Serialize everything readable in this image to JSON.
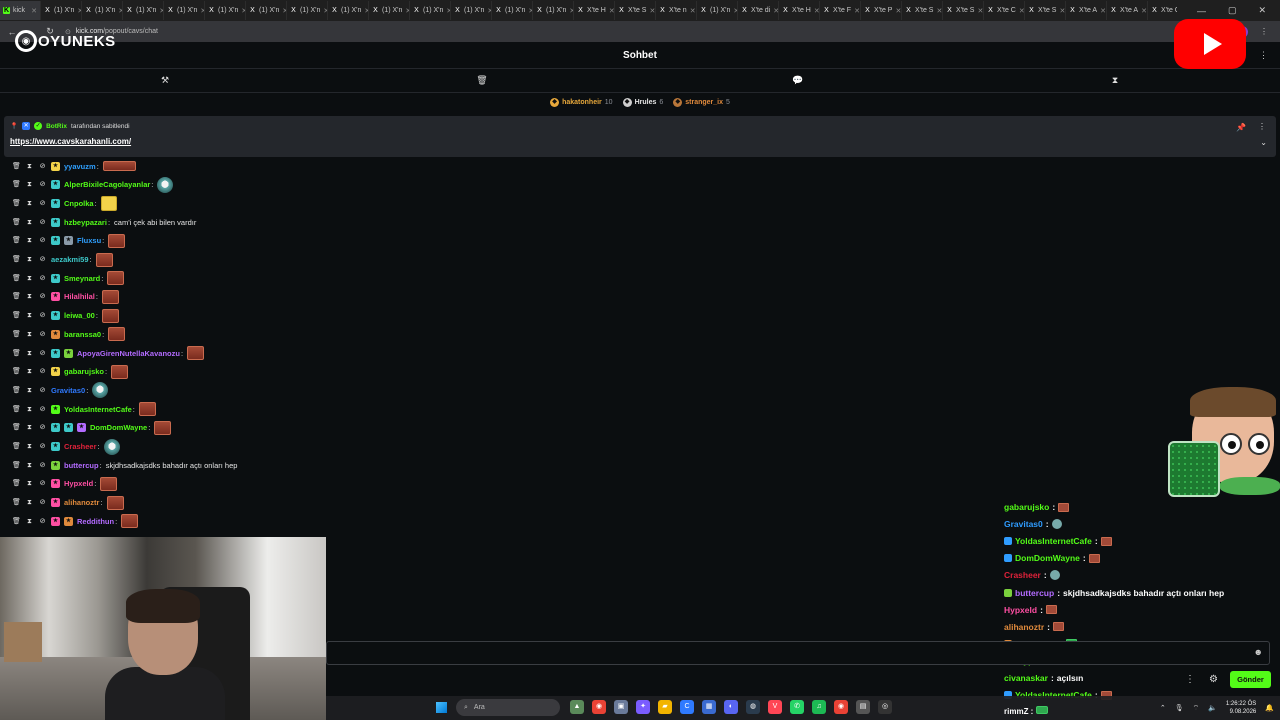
{
  "browser": {
    "tabs": [
      {
        "label": "kick",
        "active": true,
        "fav": "K"
      },
      {
        "label": "(1) X'n",
        "fav": "X"
      },
      {
        "label": "(1) X'n",
        "fav": "X"
      },
      {
        "label": "(1) X'n",
        "fav": "X"
      },
      {
        "label": "(1) X'n",
        "fav": "X"
      },
      {
        "label": "(1) X'n",
        "fav": "X"
      },
      {
        "label": "(1) X'n",
        "fav": "X"
      },
      {
        "label": "(1) X'n",
        "fav": "X"
      },
      {
        "label": "(1) X'n",
        "fav": "X"
      },
      {
        "label": "(1) X'n",
        "fav": "X"
      },
      {
        "label": "(1) X'n",
        "fav": "X"
      },
      {
        "label": "(1) X'n",
        "fav": "X"
      },
      {
        "label": "(1) X'n",
        "fav": "X"
      },
      {
        "label": "(1) X'n",
        "fav": "X"
      },
      {
        "label": "X'te H",
        "fav": "X"
      },
      {
        "label": "X'te S",
        "fav": "X"
      },
      {
        "label": "X'te n",
        "fav": "X"
      },
      {
        "label": "(1) X'n",
        "fav": "X"
      },
      {
        "label": "X'te di",
        "fav": "X"
      },
      {
        "label": "X'te H",
        "fav": "X"
      },
      {
        "label": "X'te F",
        "fav": "X"
      },
      {
        "label": "X'te P",
        "fav": "X"
      },
      {
        "label": "X'te S",
        "fav": "X"
      },
      {
        "label": "X'te S",
        "fav": "X"
      },
      {
        "label": "X'te C",
        "fav": "X"
      },
      {
        "label": "X'te S",
        "fav": "X"
      },
      {
        "label": "X'te A",
        "fav": "X"
      },
      {
        "label": "X'te A",
        "fav": "X"
      },
      {
        "label": "X'te G",
        "fav": "X"
      }
    ],
    "new_tab": "+",
    "url_host": "kick.com",
    "url_path": "/popout/cavs/chat",
    "profile": "C"
  },
  "overlay": {
    "logo_text": "OYUNEKS",
    "logo_o": "◉"
  },
  "header": {
    "title": "Sohbet",
    "menu_icon": "⋮"
  },
  "toolbar": {
    "icons": [
      {
        "name": "hammer-icon",
        "glyph": "⚒"
      },
      {
        "name": "trash-icon",
        "glyph": "🗑"
      },
      {
        "name": "chat-bubble-icon",
        "glyph": "💬"
      },
      {
        "name": "hourglass-icon",
        "glyph": "⧗"
      }
    ]
  },
  "gifters": [
    {
      "name": "hakatonheir",
      "count": "10",
      "color": "#e7a83b",
      "coin": "#e7a83b"
    },
    {
      "name": "Hrules",
      "count": "6",
      "color": "#e6e6e6",
      "coin": "#cfcfcf"
    },
    {
      "name": "stranger_ix",
      "count": "5",
      "color": "#e08a3c",
      "coin": "#b9773a"
    }
  ],
  "pinned": {
    "author": "BotRix",
    "suffix": "tarafından sabitlendi",
    "link": "https://www.cavskarahanli.com/",
    "pin_icon": "📌",
    "menu_icon": "⋮",
    "chevron_icon": "⌄"
  },
  "messages": [
    {
      "user": "yyavuzm",
      "color": "#2fa0ff",
      "badges": [
        "#f3d34a"
      ],
      "text": "",
      "emote": "wide"
    },
    {
      "user": "AlperBixileCagolayanlar",
      "color": "#53fc18",
      "badges": [
        "#3dc9c9"
      ],
      "text": "",
      "emote": "face"
    },
    {
      "user": "Cnpolka",
      "color": "#53fc18",
      "badges": [
        "#3dc9c9"
      ],
      "text": "",
      "emote": "coin"
    },
    {
      "user": "hzbeypazari",
      "color": "#53fc18",
      "badges": [
        "#3dc9c9"
      ],
      "text": "cam'i çek abi bilen vardır",
      "emote": ""
    },
    {
      "user": "Fluxsu",
      "color": "#2fa0ff",
      "badges": [
        "#3dc9c9",
        "#8a9aa8"
      ],
      "text": "",
      "emote": "box"
    },
    {
      "user": "aezakmi59",
      "color": "#3dc9c9",
      "badges": [],
      "text": "",
      "emote": "box"
    },
    {
      "user": "Smeynard",
      "color": "#53fc18",
      "badges": [
        "#3dc9c9"
      ],
      "text": "",
      "emote": "box"
    },
    {
      "user": "Hilalhilal",
      "color": "#ff4fa3",
      "badges": [
        "#ff4fa3"
      ],
      "text": "",
      "emote": "box"
    },
    {
      "user": "leiwa_00",
      "color": "#53fc18",
      "badges": [
        "#3dc9c9"
      ],
      "text": "",
      "emote": "box"
    },
    {
      "user": "baranssa0",
      "color": "#53fc18",
      "badges": [
        "#e08a3c"
      ],
      "text": "",
      "emote": "box"
    },
    {
      "user": "ApoyaGirenNutellaKavanozu",
      "color": "#b36bff",
      "badges": [
        "#3dc9c9",
        "#7bd13d"
      ],
      "text": "",
      "emote": "box"
    },
    {
      "user": "gabarujsko",
      "color": "#53fc18",
      "badges": [
        "#f3d34a"
      ],
      "text": "",
      "emote": "box"
    },
    {
      "user": "Gravitas0",
      "color": "#2f7aff",
      "badges": [],
      "text": "",
      "emote": "face"
    },
    {
      "user": "YoldasInternetCafe",
      "color": "#53fc18",
      "badges": [
        "#53fc18"
      ],
      "text": "",
      "emote": "box"
    },
    {
      "user": "DomDomWayne",
      "color": "#53fc18",
      "badges": [
        "#3dc9c9",
        "#3dc9c9",
        "#b36bff"
      ],
      "text": "",
      "emote": "box"
    },
    {
      "user": "Crasheer",
      "color": "#e0223a",
      "badges": [
        "#3dc9c9"
      ],
      "text": "",
      "emote": "face"
    },
    {
      "user": "buttercup",
      "color": "#b36bff",
      "badges": [
        "#7bd13d"
      ],
      "text": "skjdhsadkajsdks bahadır açtı onları hep",
      "emote": ""
    },
    {
      "user": "Hypxeld",
      "color": "#ff4fa3",
      "badges": [
        "#ff4fa3"
      ],
      "text": "",
      "emote": "box"
    },
    {
      "user": "alihanoztr",
      "color": "#e08a3c",
      "badges": [
        "#ff4fa3"
      ],
      "text": "",
      "emote": "box"
    },
    {
      "user": "Reddithun",
      "color": "#b36bff",
      "badges": [
        "#ff4fa3",
        "#e08a3c"
      ],
      "text": "",
      "emote": "box"
    }
  ],
  "overlay_chat": [
    {
      "user": "gabarujsko",
      "color": "#53fc18",
      "badge": "",
      "text": "",
      "emote": "box"
    },
    {
      "user": "Gravitas0",
      "color": "#2f9cff",
      "badge": "",
      "text": "",
      "emote": "face"
    },
    {
      "user": "YoldasInternetCafe",
      "color": "#53fc18",
      "badge": "#2f9cff",
      "text": "",
      "emote": "box"
    },
    {
      "user": "DomDomWayne",
      "color": "#53fc18",
      "badge": "#2f9cff",
      "text": "",
      "emote": "box"
    },
    {
      "user": "Crasheer",
      "color": "#e0223a",
      "badge": "",
      "text": "",
      "emote": "face"
    },
    {
      "user": "buttercup",
      "color": "#b36bff",
      "badge": "#7bd13d",
      "text": "skjdhsadkajsdks bahadır açtı onları hep",
      "emote": ""
    },
    {
      "user": "Hypxeld",
      "color": "#ff4fa3",
      "badge": "",
      "text": "",
      "emote": "box"
    },
    {
      "user": "alihanoztr",
      "color": "#e08a3c",
      "badge": "",
      "text": "",
      "emote": "box"
    },
    {
      "user": "Reddithun",
      "color": "#b36bff",
      "badge": "#e08a3c",
      "text": "",
      "emote": "green"
    },
    {
      "user": "hzbeypazari",
      "color": "#53fc18",
      "badge": "",
      "text": "",
      "emote": "box"
    },
    {
      "user": "civanaskar",
      "color": "#53fc18",
      "badge": "",
      "text": "açılsın",
      "emote": ""
    },
    {
      "user": "YoldasInternetCafe",
      "color": "#53fc18",
      "badge": "#2f9cff",
      "text": "",
      "emote": "box"
    }
  ],
  "overlay_bottom_user": "rimmZ :",
  "input": {
    "emoji_icon": "☻",
    "send_label": "Gönder",
    "menu_icon": "⋮",
    "settings_icon": "⚙"
  },
  "taskbar": {
    "search_label": "Ara",
    "search_icon": "⌕",
    "apps": [
      {
        "name": "landscape-app-icon",
        "color": "#5a8a5a",
        "glyph": "▲"
      },
      {
        "name": "chrome-icon",
        "color": "#e94235",
        "glyph": "◉"
      },
      {
        "name": "notes-app-icon",
        "color": "#6a7a9a",
        "glyph": "▣"
      },
      {
        "name": "copilot-icon",
        "color": "#7a5cff",
        "glyph": "✦"
      },
      {
        "name": "file-explorer-icon",
        "color": "#f2b400",
        "glyph": "▰"
      },
      {
        "name": "c-app-icon",
        "color": "#2f7aff",
        "glyph": "C"
      },
      {
        "name": "calendar-icon",
        "color": "#3a6ad0",
        "glyph": "▦"
      },
      {
        "name": "discord-icon",
        "color": "#5865f2",
        "glyph": "◐"
      },
      {
        "name": "steam-icon",
        "color": "#2a3b4d",
        "glyph": "◍"
      },
      {
        "name": "valorant-icon",
        "color": "#ff4655",
        "glyph": "V"
      },
      {
        "name": "whatsapp-icon",
        "color": "#25d366",
        "glyph": "✆"
      },
      {
        "name": "spotify-icon",
        "color": "#1db954",
        "glyph": "♫"
      },
      {
        "name": "chrome-active-icon",
        "color": "#e94235",
        "glyph": "◉"
      },
      {
        "name": "app-gray-icon",
        "color": "#555",
        "glyph": "▤"
      },
      {
        "name": "obs-icon",
        "color": "#333",
        "glyph": "◎"
      }
    ],
    "tray_chevron": "⌃",
    "time": "1:26:22 ÖS",
    "date": "9.08.2026"
  }
}
